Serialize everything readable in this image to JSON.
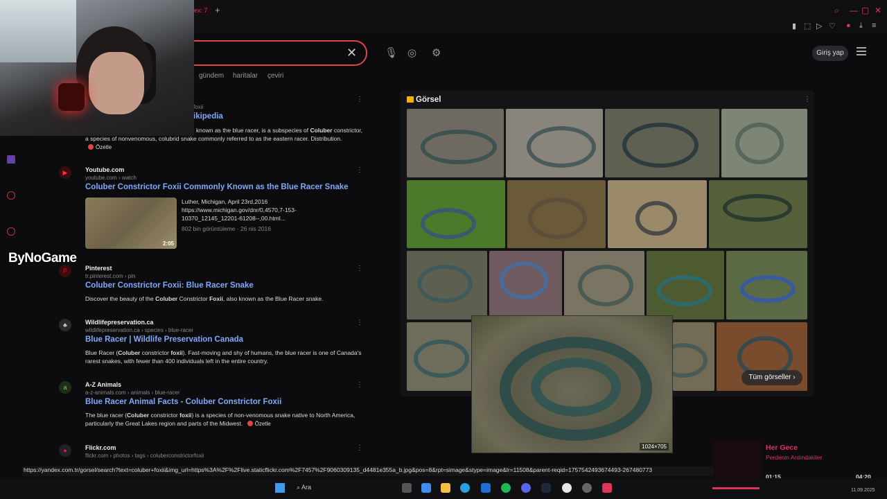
{
  "browser": {
    "tab_label": "ex: 7",
    "new_tab": "+"
  },
  "search": {
    "clear_icon": "close-icon",
    "nav_links": [
      "gündem",
      "haritalar",
      "çeviri"
    ],
    "login_label": "Giriş yap"
  },
  "results": [
    {
      "site": "",
      "crumb": "foxii",
      "title": "ikipedia",
      "snippet_parts": [
        "known as the blue racer, is a subspecies of ",
        "Coluber",
        " constrictor, a species of nonvenomous, colubrid snake commonly referred to as the eastern racer. Distribution. "
      ],
      "ozetle": "Özetle"
    },
    {
      "site": "Youtube.com",
      "crumb": "youtube.com › watch",
      "title": "Coluber Constrictor Foxii Commonly Known as the Blue Racer Snake",
      "video_meta": "Luther, Michigan, April 23rd,2016 https://www.michigan.gov/dnr/0,4570,7-153-10370_12145_12201-61208--,00.html...",
      "video_views": "802 bin görüntüleme · 26 nis 2016",
      "video_duration": "2:05"
    },
    {
      "site": "Pinterest",
      "crumb": "tr.pinterest.com › pin",
      "title": "Coluber Constrictor Foxii: Blue Racer Snake",
      "snippet_parts": [
        "Discover the beauty of the ",
        "Coluber",
        " Constrictor ",
        "Foxii",
        ", also known as the Blue Racer snake."
      ]
    },
    {
      "site": "Wildlifepreservation.ca",
      "crumb": "wildlifepreservation.ca › species › blue-racer",
      "title": "Blue Racer | Wildlife Preservation Canada",
      "snippet_parts": [
        "Blue Racer (",
        "Coluber",
        " constrictor ",
        "foxii",
        "). Fast-moving and shy of humans, the blue racer is one of Canada's rarest snakes, with fewer than 400 individuals left in the entire country."
      ]
    },
    {
      "site": "A-Z Animals",
      "crumb": "a-z-animals.com › animals › blue-racer",
      "title": "Blue Racer Animal Facts - Coluber Constrictor Foxii",
      "snippet_parts": [
        "The blue racer (",
        "Coluber",
        " constrictor ",
        "foxii",
        ") is a species of non-venomous snake native to North America, particularly the Great Lakes region and parts of the Midwest. "
      ],
      "ozetle": "Özetle"
    },
    {
      "site": "Flickr.com",
      "crumb": "flickr.com › photos › tags › coluberconstrictorfoxii",
      "title": ""
    }
  ],
  "images_panel": {
    "title": "Görsel",
    "hover_size": "1024×705",
    "all_images_label": "Tüm görseller"
  },
  "overlay": {
    "logo_text": "ByNoGame"
  },
  "status_url": "https://yandex.com.tr/gorsel/search?text=coluber+foxii&img_url=https%3A%2F%2Flive.staticflickr.com%2F7457%2F9060309135_d4481e355a_b.jpg&pos=8&rpt=simage&stype=image&lr=11508&parent-reqid=1757542493674493-267480773",
  "now_playing": {
    "title": "Her Gece",
    "artist": "Perdenin Ardındakiler",
    "elapsed": "01:15",
    "total": "04:20"
  },
  "taskbar": {
    "search_label": "Ara",
    "date": "11.09.2025"
  },
  "colors": {
    "accent": "#e0335a",
    "link": "#7fa9f7",
    "search_border": "#e04646"
  }
}
